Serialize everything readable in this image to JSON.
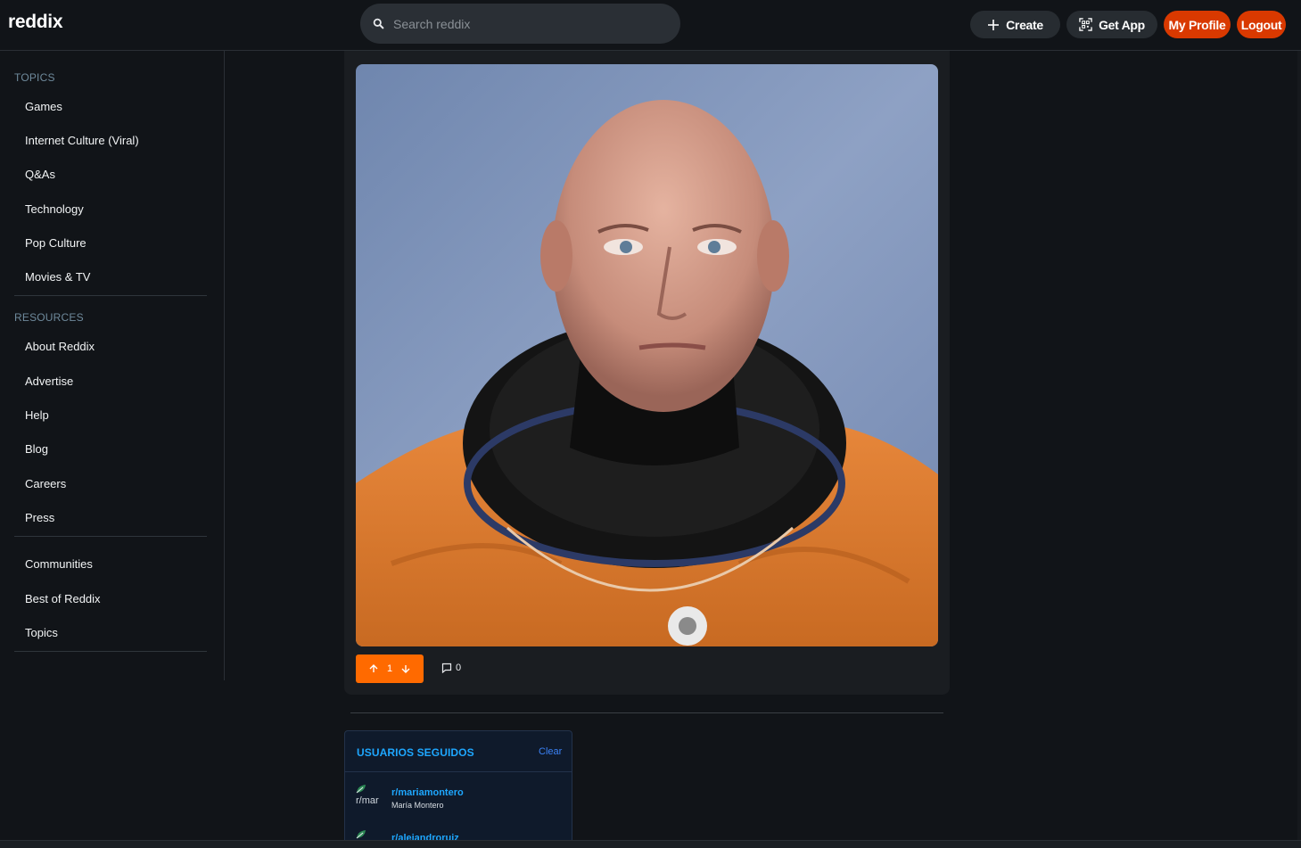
{
  "app": {
    "logo": "reddix"
  },
  "header": {
    "search_placeholder": "Search reddix",
    "create_label": "Create",
    "getapp_label": "Get App",
    "profile_label": "My Profile",
    "logout_label": "Logout"
  },
  "sidebar": {
    "topics_title": "TOPICS",
    "topics": [
      "Games",
      "Internet Culture (Viral)",
      "Q&As",
      "Technology",
      "Pop Culture",
      "Movies & TV"
    ],
    "resources_title": "RESOURCES",
    "resources": [
      "About Reddix",
      "Advertise",
      "Help",
      "Blog",
      "Careers",
      "Press"
    ],
    "more": [
      "Communities",
      "Best of Reddix",
      "Topics"
    ]
  },
  "post": {
    "vote_count": "1",
    "comment_count": "0"
  },
  "following": {
    "title": "USUARIOS SEGUIDOS",
    "clear_label": "Clear",
    "users": [
      {
        "handle": "r/mariamontero",
        "name": "María Montero",
        "avatar_alt": "r/mar"
      },
      {
        "handle": "r/alejandroruiz",
        "name": "",
        "avatar_alt": ""
      }
    ]
  },
  "colors": {
    "accent": "#ff6a00",
    "danger": "#d93900",
    "link": "#1ea7ff"
  }
}
